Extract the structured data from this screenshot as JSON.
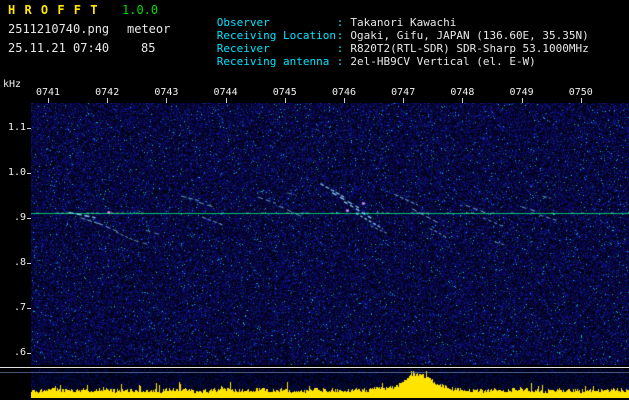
{
  "header": {
    "app_name": "H R O F F T",
    "version": "1.0.0",
    "filename": "2511210740.png",
    "mode": "meteor",
    "datetime": "25.11.21 07:40",
    "count": "85"
  },
  "info": {
    "colon": ":",
    "rows": [
      {
        "label": "Observer",
        "value": "Takanori Kawachi"
      },
      {
        "label": "Receiving Location",
        "value": "Ogaki, Gifu, JAPAN (136.60E, 35.35N)"
      },
      {
        "label": "Receiver",
        "value": "R820T2(RTL-SDR) SDR-Sharp 53.1000MHz"
      },
      {
        "label": "Receiving antenna",
        "value": "2el-HB9CV Vertical (el. E-W)"
      }
    ]
  },
  "colors": {
    "background": "#000000",
    "title_yellow": "#ffe400",
    "version_green": "#00d900",
    "info_label_cyan": "#00e5ff",
    "text_white": "#e8e8e8",
    "carrier_line_green": "#00c878",
    "echo_cyan": "#8cd7ff",
    "bright_spot_magenta": "#ff8cff",
    "level_bar_yellow": "#ffe400"
  },
  "chart_data": {
    "type": "heatmap",
    "x_ticks": [
      "0741",
      "0742",
      "0743",
      "0744",
      "0745",
      "0746",
      "0747",
      "0748",
      "0749",
      "0750"
    ],
    "y_unit": "kHz",
    "y_ticks": [
      "1.1",
      "1.0",
      ".9",
      ".8",
      ".7",
      ".6"
    ],
    "ylim": [
      0.573,
      1.155
    ],
    "x_minutes_range": [
      0,
      10
    ],
    "grid": false,
    "carrier_khz": 0.91,
    "echoes": [
      {
        "t": 1.35,
        "f": 0.912,
        "dt": 0.45,
        "df": -0.012,
        "i": 0.95
      },
      {
        "t": 1.55,
        "f": 0.9,
        "dt": 0.35,
        "df": -0.015,
        "i": 0.8
      },
      {
        "t": 1.85,
        "f": 0.888,
        "dt": 0.35,
        "df": -0.02,
        "i": 0.75
      },
      {
        "t": 2.15,
        "f": 0.868,
        "dt": 0.3,
        "df": -0.018,
        "i": 0.7
      },
      {
        "t": 2.45,
        "f": 0.85,
        "dt": 0.25,
        "df": -0.01,
        "i": 0.6
      },
      {
        "t": 2.65,
        "f": 0.872,
        "dt": 0.3,
        "df": -0.012,
        "i": 0.6
      },
      {
        "t": 3.25,
        "f": 0.948,
        "dt": 0.3,
        "df": -0.01,
        "i": 0.7
      },
      {
        "t": 3.55,
        "f": 0.934,
        "dt": 0.3,
        "df": -0.012,
        "i": 0.75
      },
      {
        "t": 3.6,
        "f": 0.902,
        "dt": 0.35,
        "df": -0.018,
        "i": 0.7
      },
      {
        "t": 4.55,
        "f": 0.946,
        "dt": 0.3,
        "df": -0.014,
        "i": 0.7
      },
      {
        "t": 4.9,
        "f": 0.926,
        "dt": 0.4,
        "df": -0.024,
        "i": 0.75
      },
      {
        "t": 5.05,
        "f": 0.955,
        "dt": 0.15,
        "df": -0.005,
        "i": 0.6
      },
      {
        "t": 5.6,
        "f": 0.976,
        "dt": 0.4,
        "df": -0.03,
        "i": 0.85
      },
      {
        "t": 5.8,
        "f": 0.956,
        "dt": 0.45,
        "df": -0.034,
        "i": 0.9
      },
      {
        "t": 6.0,
        "f": 0.936,
        "dt": 0.5,
        "df": -0.04,
        "i": 0.9
      },
      {
        "t": 6.2,
        "f": 0.91,
        "dt": 0.45,
        "df": -0.034,
        "i": 0.85
      },
      {
        "t": 6.45,
        "f": 0.882,
        "dt": 0.3,
        "df": -0.018,
        "i": 0.7
      },
      {
        "t": 6.85,
        "f": 0.952,
        "dt": 0.4,
        "df": -0.024,
        "i": 0.8
      },
      {
        "t": 7.15,
        "f": 0.92,
        "dt": 0.45,
        "df": -0.032,
        "i": 0.8
      },
      {
        "t": 7.45,
        "f": 0.876,
        "dt": 0.3,
        "df": -0.02,
        "i": 0.7
      },
      {
        "t": 8.05,
        "f": 0.928,
        "dt": 0.4,
        "df": -0.02,
        "i": 0.75
      },
      {
        "t": 8.35,
        "f": 0.9,
        "dt": 0.35,
        "df": -0.02,
        "i": 0.7
      },
      {
        "t": 8.55,
        "f": 0.846,
        "dt": 0.2,
        "df": -0.008,
        "i": 0.6
      },
      {
        "t": 9.0,
        "f": 0.924,
        "dt": 0.3,
        "df": -0.012,
        "i": 0.7
      },
      {
        "t": 9.3,
        "f": 0.906,
        "dt": 0.3,
        "df": -0.012,
        "i": 0.65
      },
      {
        "t": 9.35,
        "f": 0.948,
        "dt": 0.15,
        "df": -0.005,
        "i": 0.6
      }
    ],
    "bright_spots": [
      {
        "t": 6.05,
        "f": 0.916
      },
      {
        "t": 6.32,
        "f": 0.932
      },
      {
        "t": 2.02,
        "f": 0.912
      }
    ],
    "level_profile": [
      0.3,
      0.26,
      0.32,
      0.28,
      0.25,
      0.3,
      0.34,
      0.28,
      0.26,
      0.31,
      0.29,
      0.27,
      0.33,
      0.3,
      0.26,
      0.28,
      0.35,
      0.3,
      0.27,
      0.32,
      0.28,
      0.3,
      0.26,
      0.29,
      0.33,
      0.3,
      0.28,
      0.32,
      0.3,
      0.34,
      0.38,
      0.55,
      0.95,
      0.85,
      0.55,
      0.38,
      0.32,
      0.29,
      0.27,
      0.31,
      0.3,
      0.33,
      0.28,
      0.26,
      0.31,
      0.29,
      0.27,
      0.3,
      0.28,
      0.32,
      0.29
    ]
  }
}
